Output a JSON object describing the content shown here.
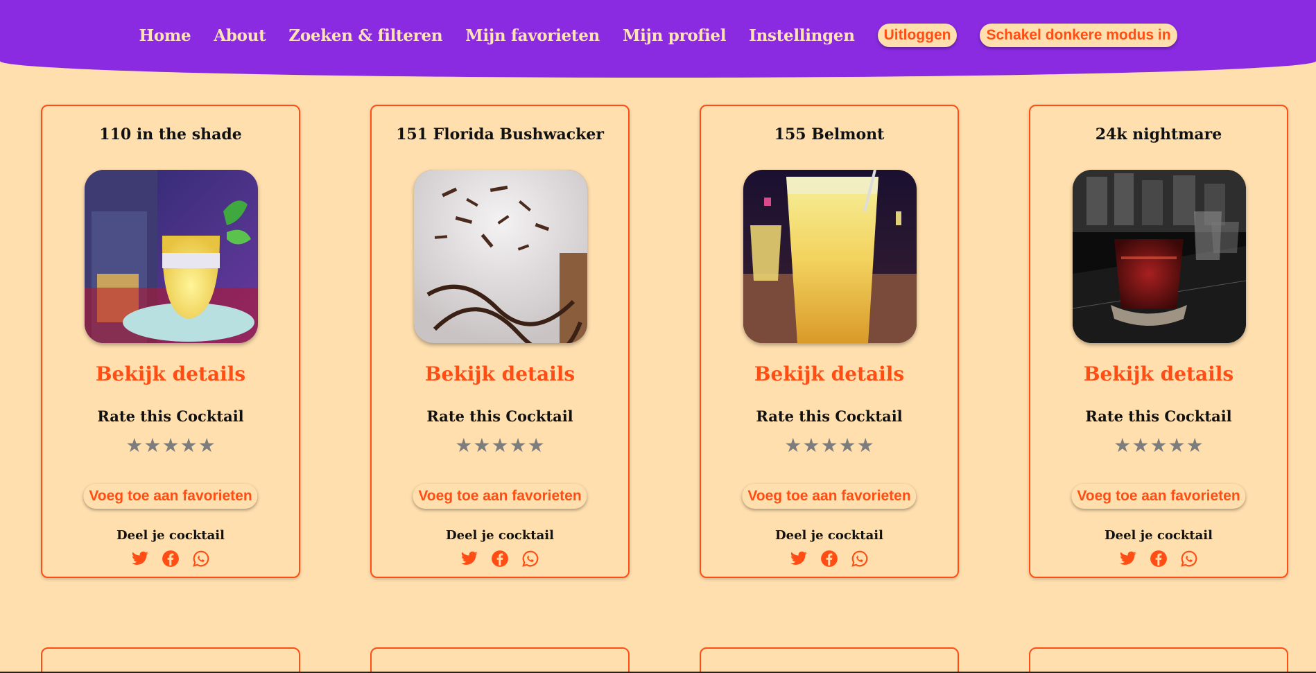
{
  "nav": {
    "links": [
      "Home",
      "About",
      "Zoeken & filteren",
      "Mijn favorieten",
      "Mijn profiel",
      "Instellingen"
    ],
    "logout_label": "Uitloggen",
    "dark_mode_label": "Schakel donkere modus in"
  },
  "cards": [
    {
      "title": "110 in the shade",
      "details_label": "Bekijk details",
      "rate_label": "Rate this Cocktail",
      "rating": 0,
      "favorite_label": "Voeg toe aan favorieten",
      "share_label": "Deel je cocktail"
    },
    {
      "title": "151 Florida Bushwacker",
      "details_label": "Bekijk details",
      "rate_label": "Rate this Cocktail",
      "rating": 0,
      "favorite_label": "Voeg toe aan favorieten",
      "share_label": "Deel je cocktail"
    },
    {
      "title": "155 Belmont",
      "details_label": "Bekijk details",
      "rate_label": "Rate this Cocktail",
      "rating": 0,
      "favorite_label": "Voeg toe aan favorieten",
      "share_label": "Deel je cocktail"
    },
    {
      "title": "24k nightmare",
      "details_label": "Bekijk details",
      "rate_label": "Rate this Cocktail",
      "rating": 0,
      "favorite_label": "Voeg toe aan favorieten",
      "share_label": "Deel je cocktail"
    }
  ],
  "share_icons": [
    "twitter-icon",
    "facebook-icon",
    "whatsapp-icon"
  ],
  "colors": {
    "background": "#ffdfae",
    "header": "#8a2be2",
    "accent": "#ff4d14",
    "nav_text": "#ffe3b6",
    "star": "#7d7d7d"
  }
}
